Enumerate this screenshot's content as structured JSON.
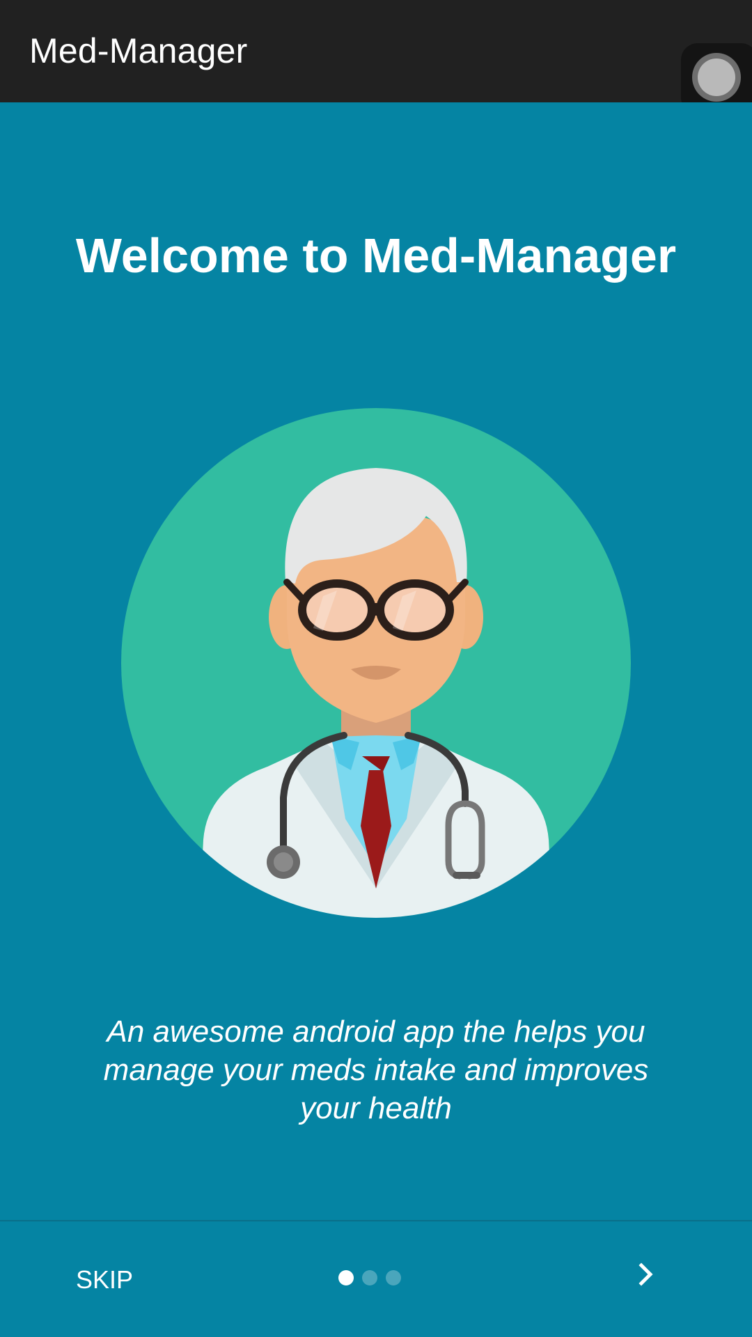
{
  "toolbar": {
    "title": "Med-Manager"
  },
  "onboarding": {
    "title": "Welcome to Med-Manager",
    "description": "An awesome android app the helps you manage your meds intake and improves your health",
    "illustration_icon": "doctor-avatar-icon",
    "page_index": 1,
    "page_count": 3
  },
  "bottom_bar": {
    "skip_label": "SKIP",
    "next_icon": "chevron-right-icon"
  },
  "colors": {
    "toolbar": "#212121",
    "background": "#0584a3",
    "circle": "#32bda1",
    "text": "#ffffff"
  }
}
